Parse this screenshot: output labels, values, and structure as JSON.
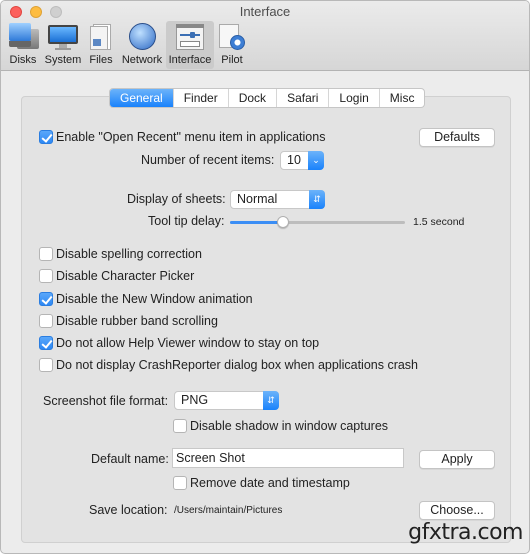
{
  "window": {
    "title": "Interface"
  },
  "toolbar": {
    "items": [
      {
        "label": "Disks",
        "icon": "disks-icon"
      },
      {
        "label": "System",
        "icon": "system-icon"
      },
      {
        "label": "Files",
        "icon": "files-icon"
      },
      {
        "label": "Network",
        "icon": "network-icon"
      },
      {
        "label": "Interface",
        "icon": "interface-icon",
        "active": true
      },
      {
        "label": "Pilot",
        "icon": "pilot-icon"
      }
    ]
  },
  "tabs": [
    {
      "label": "General",
      "active": true
    },
    {
      "label": "Finder"
    },
    {
      "label": "Dock"
    },
    {
      "label": "Safari"
    },
    {
      "label": "Login"
    },
    {
      "label": "Misc"
    }
  ],
  "general": {
    "open_recent": {
      "label": "Enable \"Open Recent\" menu item in applications",
      "checked": true
    },
    "defaults_button": "Defaults",
    "recent_items": {
      "label": "Number of recent items:",
      "value": "10"
    },
    "sheets": {
      "label": "Display of sheets:",
      "value": "Normal"
    },
    "tooltip": {
      "label": "Tool tip delay:",
      "value_text": "1.5 second",
      "fraction": 0.3
    },
    "options": [
      {
        "label": "Disable spelling correction",
        "checked": false
      },
      {
        "label": "Disable Character Picker",
        "checked": false
      },
      {
        "label": "Disable the New Window animation",
        "checked": true
      },
      {
        "label": "Disable rubber band scrolling",
        "checked": false
      },
      {
        "label": "Do not allow Help Viewer window to stay on top",
        "checked": true
      },
      {
        "label": "Do not display CrashReporter dialog box when applications crash",
        "checked": false
      }
    ],
    "screenshot_format": {
      "label": "Screenshot file format:",
      "value": "PNG"
    },
    "disable_shadow": {
      "label": "Disable shadow in window captures",
      "checked": false
    },
    "default_name": {
      "label": "Default name:",
      "value": "Screen Shot"
    },
    "apply_button": "Apply",
    "remove_timestamp": {
      "label": "Remove date and timestamp",
      "checked": false
    },
    "save_location": {
      "label": "Save location:",
      "value": "/Users/maintain/Pictures"
    },
    "choose_button": "Choose..."
  },
  "watermark": "gfxtra.com"
}
